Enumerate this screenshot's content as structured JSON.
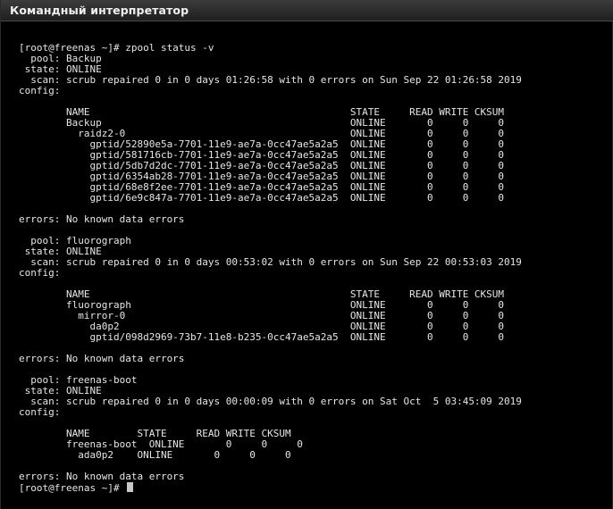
{
  "window": {
    "title": "Командный интерпретатор"
  },
  "terminal": {
    "lines": [
      "[root@freenas ~]# zpool status -v",
      "  pool: Backup",
      " state: ONLINE",
      "  scan: scrub repaired 0 in 0 days 01:26:58 with 0 errors on Sun Sep 22 01:26:58 2019",
      "config:",
      "",
      "        NAME                                            STATE     READ WRITE CKSUM",
      "        Backup                                          ONLINE       0     0     0",
      "          raidz2-0                                      ONLINE       0     0     0",
      "            gptid/52890e5a-7701-11e9-ae7a-0cc47ae5a2a5  ONLINE       0     0     0",
      "            gptid/581716cb-7701-11e9-ae7a-0cc47ae5a2a5  ONLINE       0     0     0",
      "            gptid/5db7d2dc-7701-11e9-ae7a-0cc47ae5a2a5  ONLINE       0     0     0",
      "            gptid/6354ab28-7701-11e9-ae7a-0cc47ae5a2a5  ONLINE       0     0     0",
      "            gptid/68e8f2ee-7701-11e9-ae7a-0cc47ae5a2a5  ONLINE       0     0     0",
      "            gptid/6e9c847a-7701-11e9-ae7a-0cc47ae5a2a5  ONLINE       0     0     0",
      "",
      "errors: No known data errors",
      "",
      "  pool: fluorograph",
      " state: ONLINE",
      "  scan: scrub repaired 0 in 0 days 00:53:02 with 0 errors on Sun Sep 22 00:53:03 2019",
      "config:",
      "",
      "        NAME                                            STATE     READ WRITE CKSUM",
      "        fluorograph                                     ONLINE       0     0     0",
      "          mirror-0                                      ONLINE       0     0     0",
      "            da0p2                                       ONLINE       0     0     0",
      "            gptid/098d2969-73b7-11e8-b235-0cc47ae5a2a5  ONLINE       0     0     0",
      "",
      "errors: No known data errors",
      "",
      "  pool: freenas-boot",
      " state: ONLINE",
      "  scan: scrub repaired 0 in 0 days 00:00:09 with 0 errors on Sat Oct  5 03:45:09 2019",
      "config:",
      "",
      "        NAME        STATE     READ WRITE CKSUM",
      "        freenas-boot  ONLINE       0     0     0",
      "          ada0p2    ONLINE       0     0     0",
      "",
      "errors: No known data errors",
      "[root@freenas ~]# "
    ]
  }
}
